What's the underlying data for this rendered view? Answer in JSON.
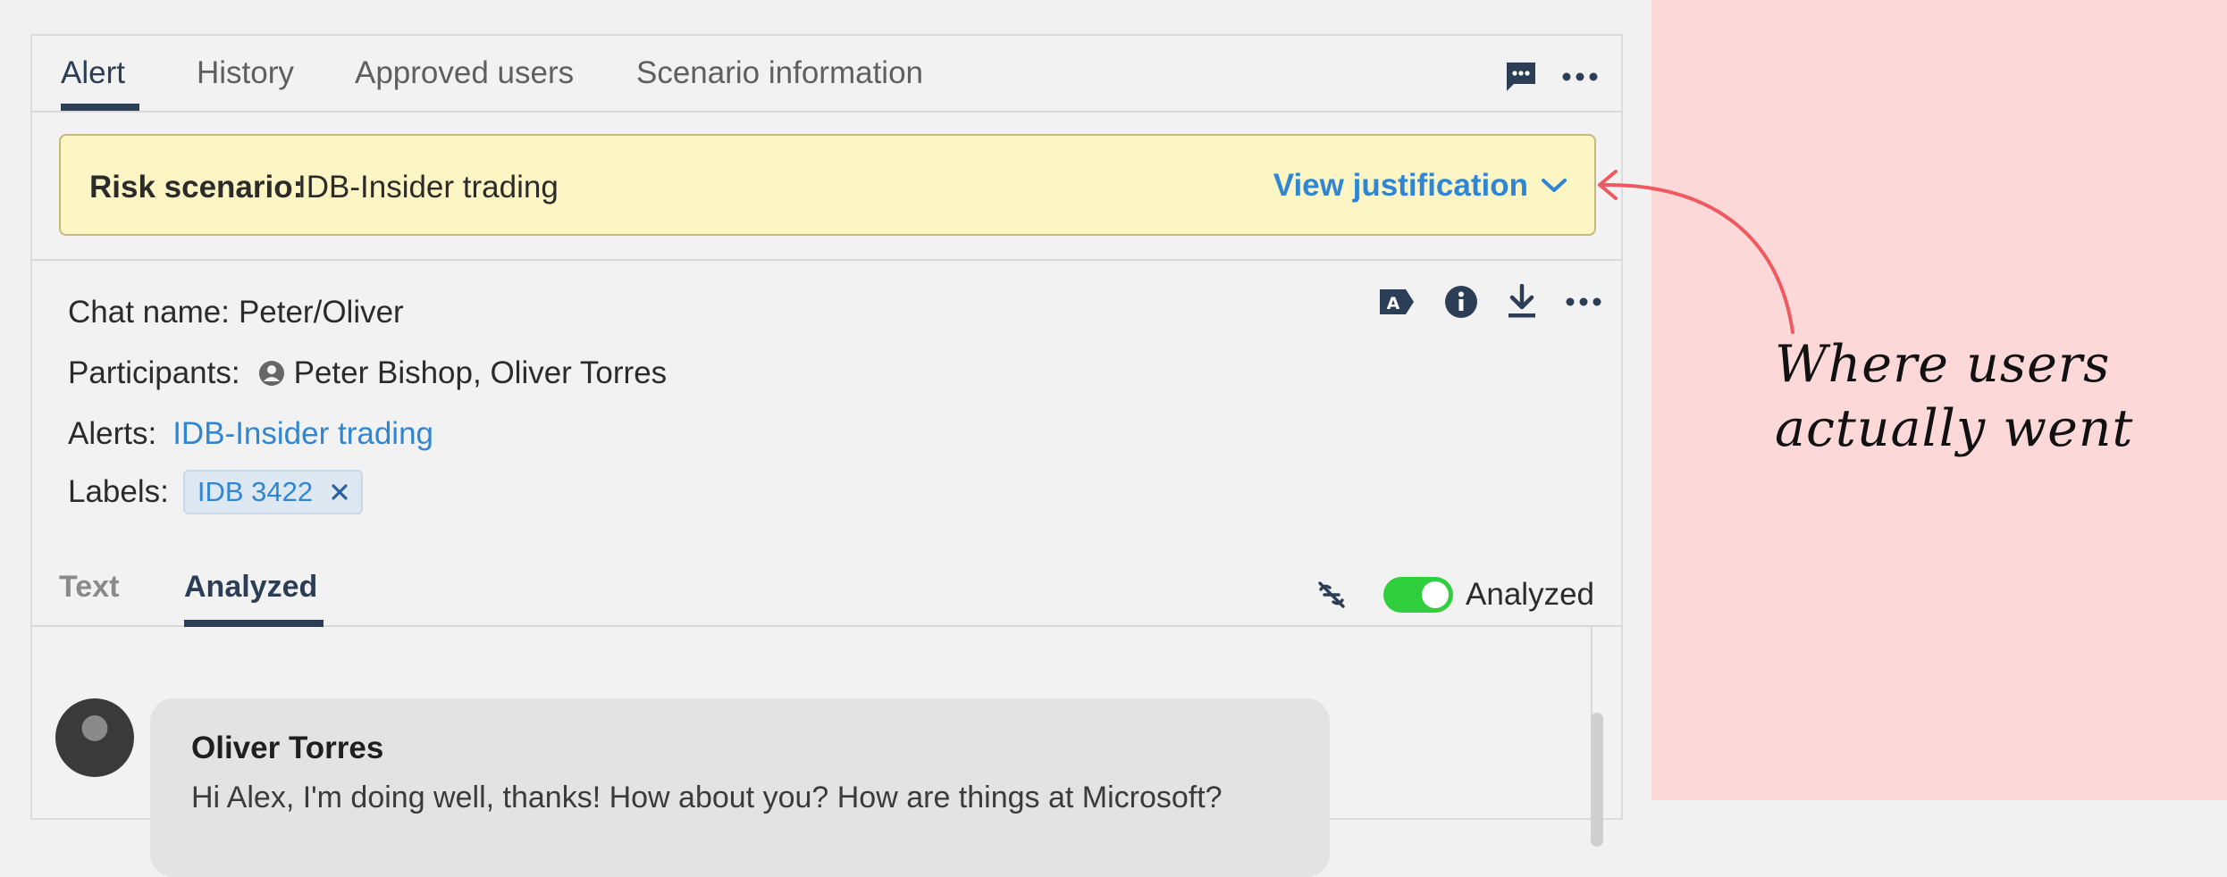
{
  "tabs": [
    {
      "label": "Alert",
      "active": true
    },
    {
      "label": "History",
      "active": false
    },
    {
      "label": "Approved users",
      "active": false
    },
    {
      "label": "Scenario information",
      "active": false
    }
  ],
  "tab_icons": [
    "message-icon",
    "more-icon"
  ],
  "banner": {
    "label": "Risk scenario:",
    "value": "IDB-Insider trading",
    "action": "View justification"
  },
  "details": {
    "chat_name_label": "Chat name:",
    "chat_name_value": "Peter/Oliver",
    "participants_label": "Participants:",
    "participants_value": "Peter Bishop, Oliver Torres",
    "alerts_label": "Alerts:",
    "alerts_value": "IDB-Insider trading",
    "labels_label": "Labels:",
    "labels": [
      {
        "text": "IDB 3422"
      }
    ]
  },
  "detail_icons": [
    "translate-icon",
    "info-icon",
    "download-icon",
    "more-icon"
  ],
  "subtabs": [
    {
      "label": "Text",
      "active": false
    },
    {
      "label": "Analyzed",
      "active": true
    }
  ],
  "toggle": {
    "label": "Analyzed",
    "on": true
  },
  "messages": [
    {
      "sender": "Oliver Torres",
      "text": "Hi Alex, I'm doing well, thanks! How about you? How are things at Microsoft?"
    }
  ],
  "annotation": {
    "line1": "Where users",
    "line2": "actually went"
  },
  "colors": {
    "accent": "#2f86d4",
    "banner_bg": "#fdf5c4",
    "toggle_on": "#2fcf3e",
    "annotation_bg": "#fdd8d8",
    "arrow": "#ef5a60"
  }
}
